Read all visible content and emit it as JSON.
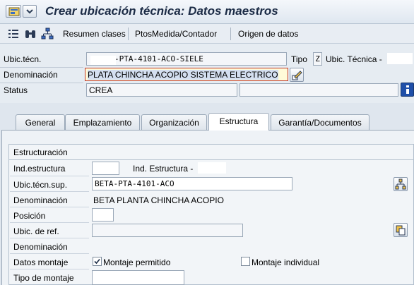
{
  "window": {
    "title": "Crear ubicación técnica: Datos maestros"
  },
  "toolbar": {
    "buttons": [
      "Resumen clases",
      "PtosMedida/Contador",
      "Origen de datos"
    ]
  },
  "header": {
    "ubic_label": "Ubic.técn.",
    "ubic_value": "-PTA-4101-ACO-SIELE",
    "tipo_label": "Tipo",
    "tipo_value": "Z",
    "tipo_text": "Ubic. Técnica -",
    "denominacion_label": "Denominación",
    "denominacion_value": "PLATA CHINCHA ACOPIO SISTEMA ELECTRICO",
    "status_label": "Status",
    "status_value": "CREA"
  },
  "tabs": [
    "General",
    "Emplazamiento",
    "Organización",
    "Estructura",
    "Garantía/Documentos"
  ],
  "active_tab": "Estructura",
  "estructura": {
    "group_title": "Estructuración",
    "ind_estructura_label": "Ind.estructura",
    "ind_estructura_text": "Ind. Estructura -",
    "ubic_sup_label": "Ubic.técn.sup.",
    "ubic_sup_value": "BETA-PTA-4101-ACO",
    "denominacion_label": "Denominación",
    "denominacion_value": "BETA PLANTA CHINCHA ACOPIO",
    "posicion_label": "Posición",
    "ubic_ref_label": "Ubic. de ref.",
    "denominacion2_label": "Denominación",
    "datos_montaje_label": "Datos montaje",
    "montaje_permitido": "Montaje permitido",
    "montaje_permitido_checked": true,
    "montaje_individual": "Montaje individual",
    "montaje_individual_checked": false,
    "tipo_montaje_label": "Tipo de montaje"
  },
  "colors": {
    "title": "#1b2b45",
    "accent_active_field": "#c0392b",
    "info_button": "#1f4fa8"
  }
}
